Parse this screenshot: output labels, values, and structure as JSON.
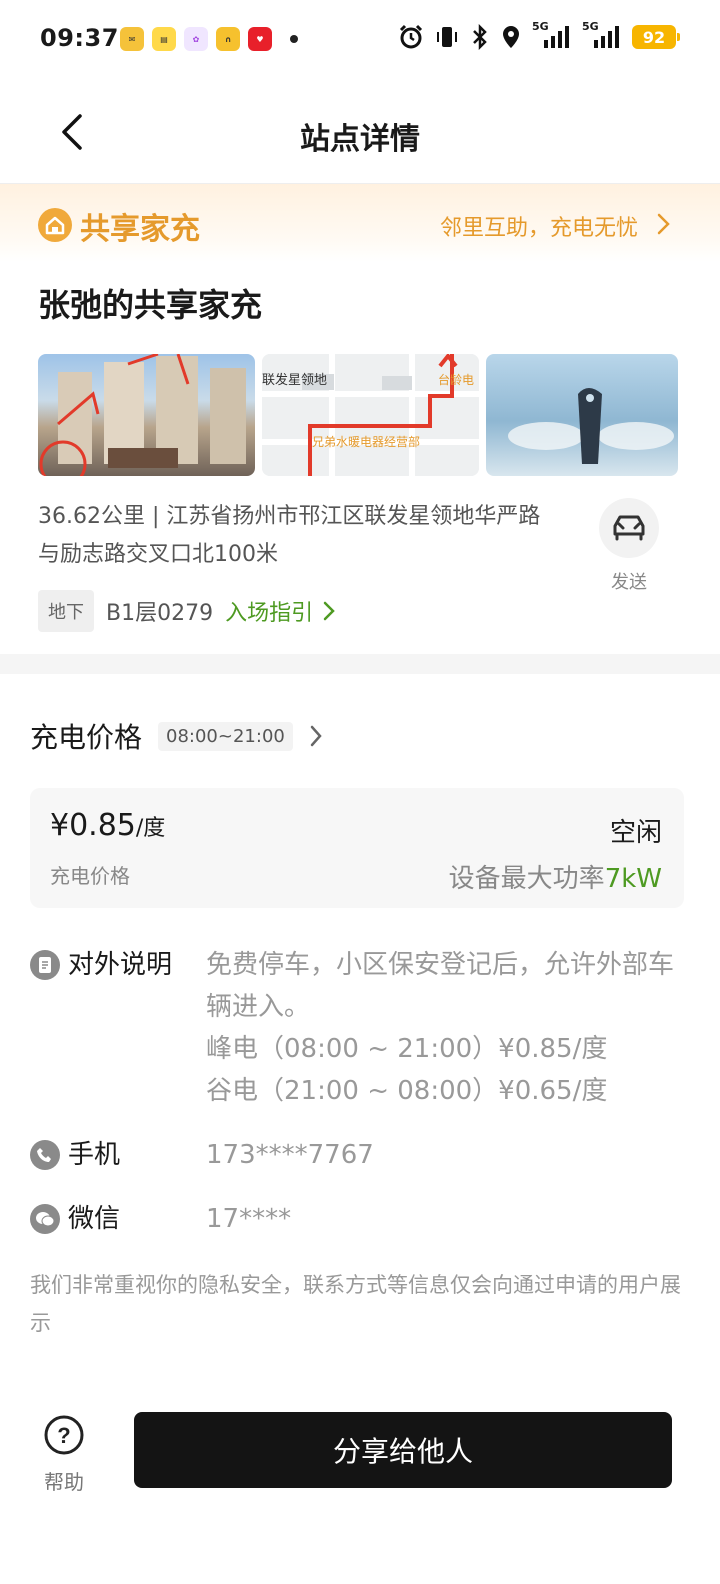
{
  "status_bar": {
    "time": "09:37",
    "battery": "92",
    "network_1": "5G",
    "network_2": "5G"
  },
  "nav": {
    "title": "站点详情"
  },
  "banner": {
    "title": "共享家充",
    "link": "邻里互助，充电无忧"
  },
  "station": {
    "name": "张弛的共享家充",
    "map_label_1": "联发星领地",
    "map_label_2": "台龄电",
    "map_label_3": "兄弟水暖电器经营部",
    "address": "36.62公里 | 江苏省扬州市邗江区联发星领地华严路与励志路交叉口北100米",
    "send_label": "发送",
    "floor_tag": "地下",
    "floor_num": "B1层0279",
    "guide": "入场指引"
  },
  "price": {
    "title": "充电价格",
    "time_range": "08:00~21:00",
    "value": "¥0.85",
    "unit": "/度",
    "label": "充电价格",
    "status": "空闲",
    "power_label": "设备最大功率",
    "power_value": "7kW"
  },
  "info": {
    "desc_label": "对外说明",
    "desc_line1": "免费停车，小区保安登记后，允许外部车辆进入。",
    "desc_line2": "峰电（08:00 ~ 21:00）¥0.85/度",
    "desc_line3": "谷电（21:00 ~ 08:00）¥0.65/度",
    "phone_label": "手机",
    "phone_value": "173****7767",
    "wechat_label": "微信",
    "wechat_value": "17****",
    "privacy": "我们非常重视你的隐私安全，联系方式等信息仅会向通过申请的用户展示"
  },
  "footer": {
    "help_label": "帮助",
    "share_label": "分享给他人"
  }
}
